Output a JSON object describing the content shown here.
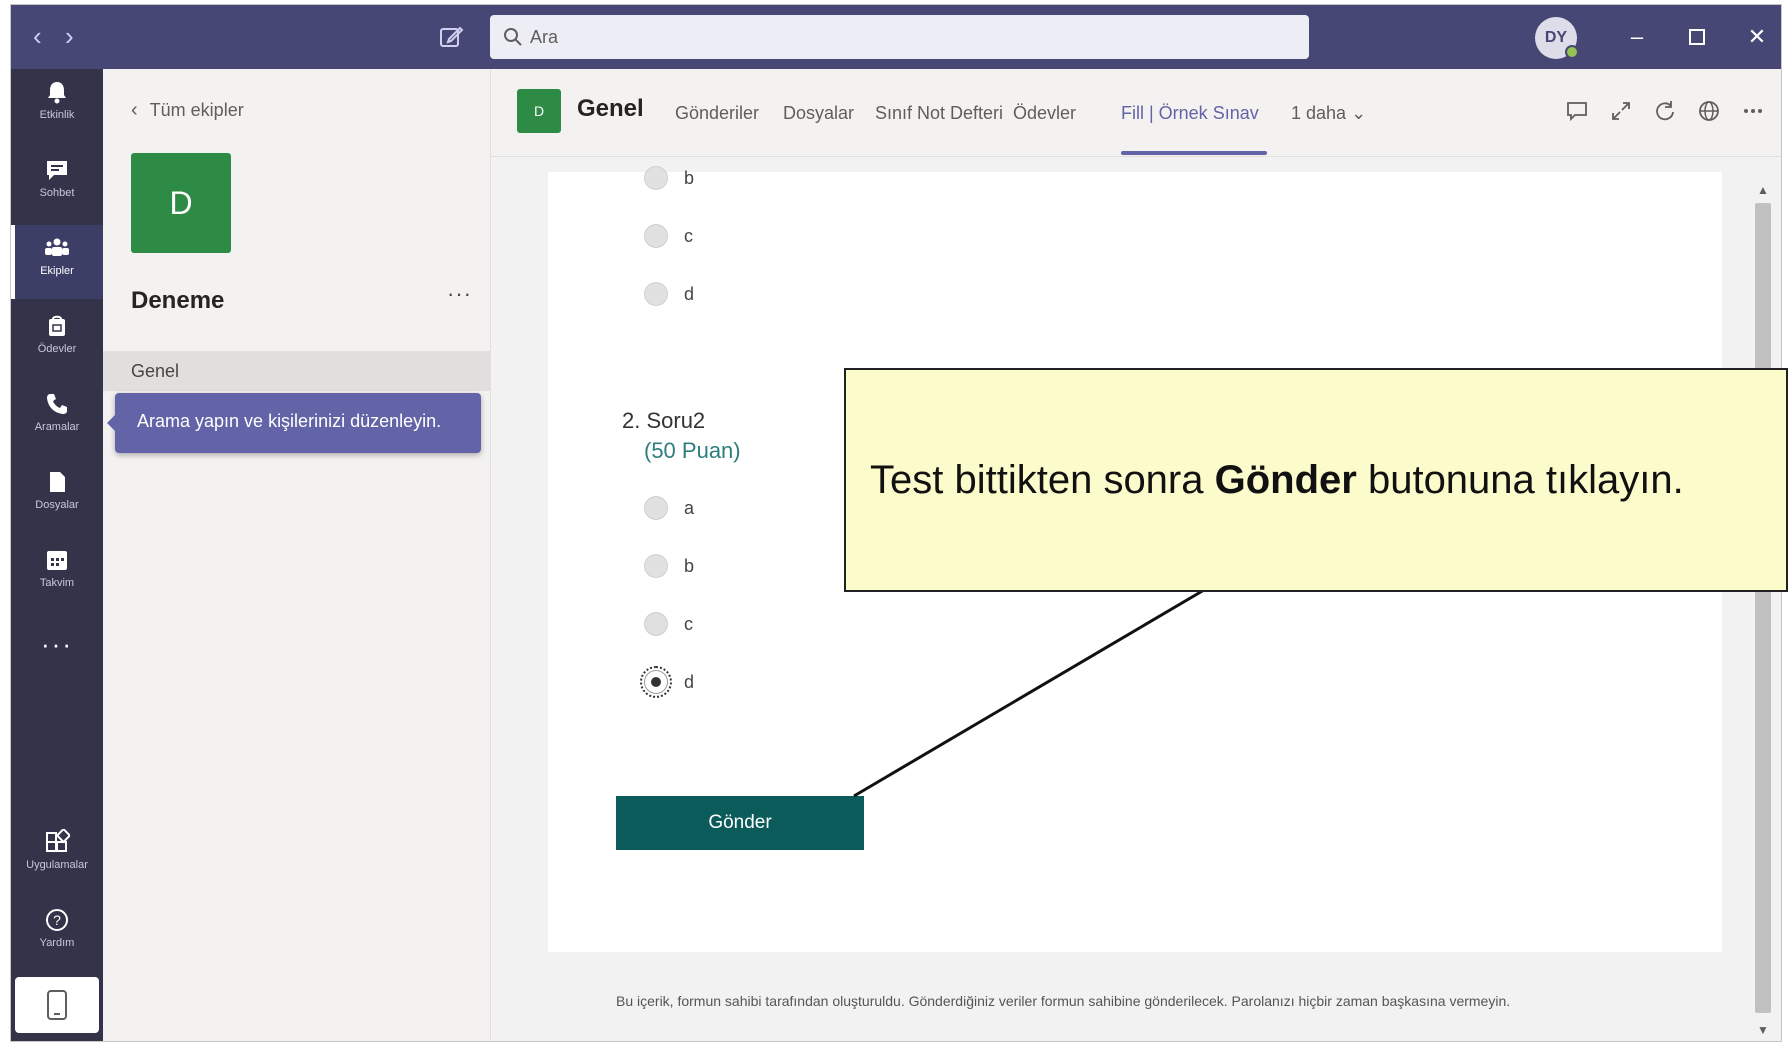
{
  "titlebar": {
    "back_icon": "chevron-left-icon",
    "forward_icon": "chevron-right-icon",
    "compose_icon": "compose-icon",
    "search_placeholder": "Ara",
    "avatar_initials": "DY",
    "presence": "available",
    "window_controls": [
      "minimize-icon",
      "maximize-icon",
      "close-icon"
    ]
  },
  "rail": {
    "items": [
      {
        "label": "Etkinlik",
        "icon": "bell-icon"
      },
      {
        "label": "Sohbet",
        "icon": "chat-icon"
      },
      {
        "label": "Ekipler",
        "icon": "teams-icon",
        "active": true
      },
      {
        "label": "Ödevler",
        "icon": "assignments-icon"
      },
      {
        "label": "Aramalar",
        "icon": "phone-icon"
      },
      {
        "label": "Dosyalar",
        "icon": "file-icon"
      },
      {
        "label": "Takvim",
        "icon": "calendar-icon"
      }
    ],
    "more": "···",
    "bottom": [
      {
        "label": "Uygulamalar",
        "icon": "apps-icon"
      },
      {
        "label": "Yardım",
        "icon": "help-icon"
      }
    ],
    "device_icon": "mobile-device-icon"
  },
  "team_panel": {
    "back_label": "Tüm ekipler",
    "tile_letter": "D",
    "team_name": "Deneme",
    "more": "···",
    "channel": "Genel",
    "tooltip": "Arama yapın ve kişilerinizi düzenleyin."
  },
  "channel_header": {
    "icon_letter": "D",
    "title": "Genel",
    "tabs": [
      "Gönderiler",
      "Dosyalar",
      "Sınıf Not Defteri",
      "Ödevler",
      "Fill | Örnek Sınav",
      "1 daha"
    ],
    "active_tab": "Fill | Örnek Sınav",
    "actions": [
      "conversation-icon",
      "expand-icon",
      "refresh-icon",
      "globe-icon",
      "more-icon"
    ]
  },
  "form": {
    "q1_options_visible": [
      "b",
      "c",
      "d"
    ],
    "question2": {
      "title": "2. Soru2",
      "points": "(50 Puan)",
      "options": [
        "a",
        "b",
        "c",
        "d"
      ],
      "selected": "d"
    },
    "submit_label": "Gönder",
    "footer": "Bu içerik, formun sahibi tarafından oluşturuldu. Gönderdiğiniz veriler formun sahibine gönderilecek. Parolanızı hiçbir zaman başkasına vermeyin."
  },
  "callout": {
    "text_before": "Test bittikten sonra ",
    "text_bold": "Gönder",
    "text_after": " butonuna tıklayın."
  },
  "colors": {
    "titlebar": "#464775",
    "rail": "#33344a",
    "accent": "#6264a7",
    "team_tile": "#2e8b45",
    "submit": "#0b5b5b",
    "callout_bg": "#fbfbcc"
  }
}
